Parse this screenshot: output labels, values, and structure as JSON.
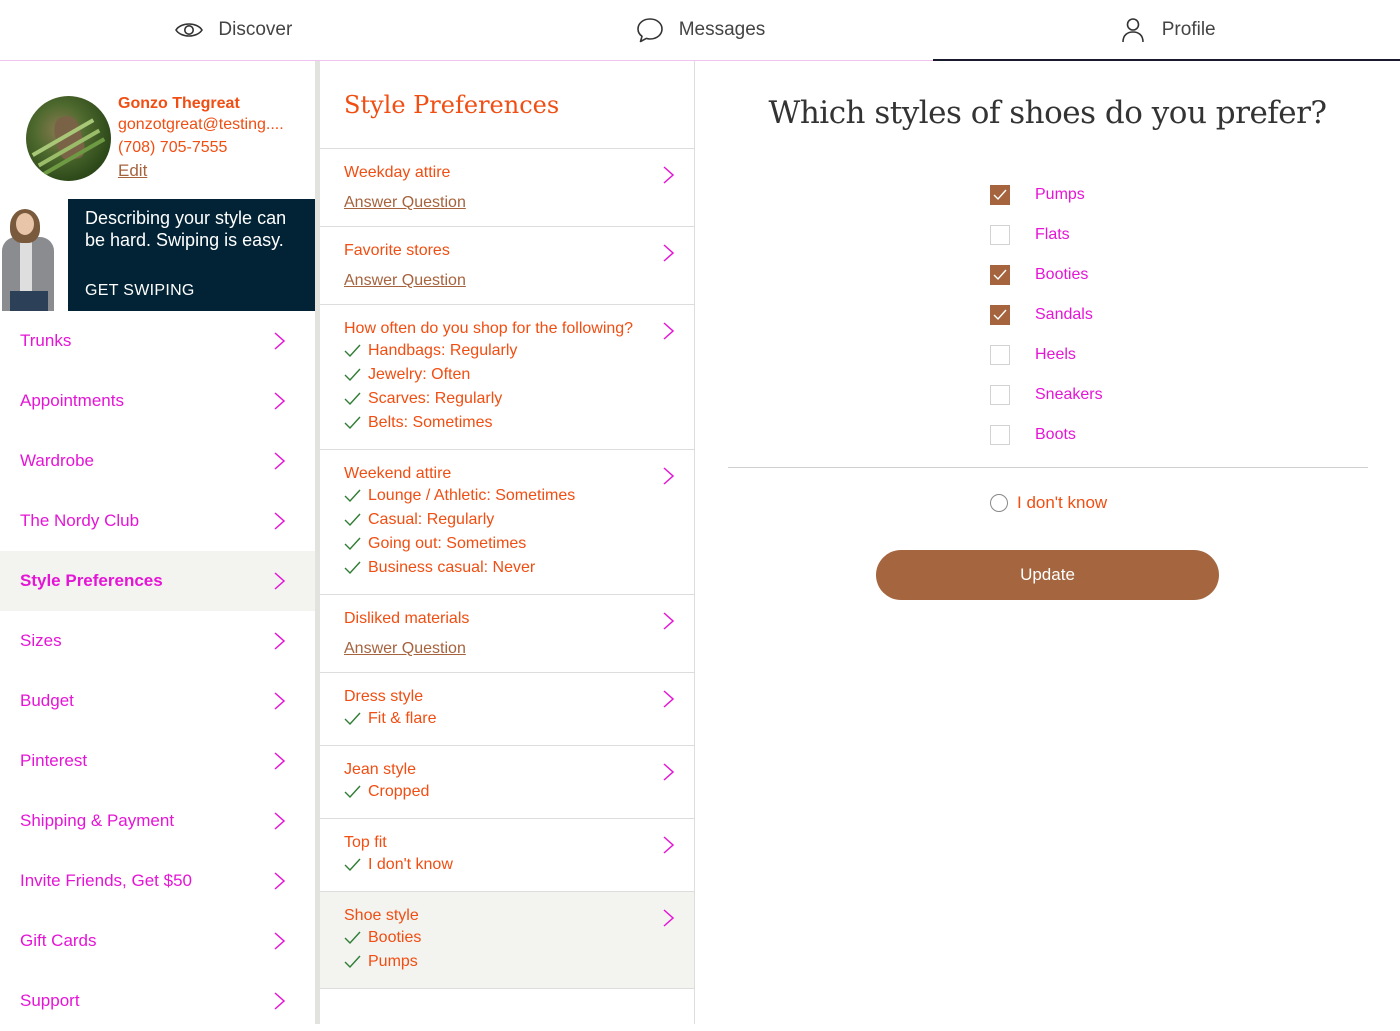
{
  "topnav": {
    "tabs": [
      {
        "label": "Discover",
        "icon": "eye-icon"
      },
      {
        "label": "Messages",
        "icon": "speech-bubble-icon"
      },
      {
        "label": "Profile",
        "icon": "person-icon",
        "active": true
      }
    ]
  },
  "profile": {
    "name": "Gonzo Thegreat",
    "email": "gonzotgreat@testing....",
    "phone": "(708) 705-7555",
    "edit_label": "Edit"
  },
  "promo": {
    "text": "Describing your style can be hard. Swiping is easy.",
    "cta": "GET SWIPING"
  },
  "sidebar": {
    "items": [
      {
        "label": "Trunks"
      },
      {
        "label": "Appointments"
      },
      {
        "label": "Wardrobe"
      },
      {
        "label": "The Nordy Club"
      },
      {
        "label": "Style Preferences",
        "active": true
      },
      {
        "label": "Sizes"
      },
      {
        "label": "Budget"
      },
      {
        "label": "Pinterest"
      },
      {
        "label": "Shipping & Payment"
      },
      {
        "label": "Invite Friends, Get $50"
      },
      {
        "label": "Gift Cards"
      },
      {
        "label": "Support"
      }
    ]
  },
  "middle": {
    "title": "Style Preferences",
    "answer_link": "Answer Question",
    "questions": [
      {
        "title": "Weekday attire",
        "answers": []
      },
      {
        "title": "Favorite stores",
        "answers": []
      },
      {
        "title": "How often do you shop for the following?",
        "answers": [
          "Handbags: Regularly",
          "Jewelry: Often",
          "Scarves: Regularly",
          "Belts: Sometimes"
        ]
      },
      {
        "title": "Weekend attire",
        "answers": [
          "Lounge / Athletic: Sometimes",
          "Casual: Regularly",
          "Going out: Sometimes",
          "Business casual: Never"
        ]
      },
      {
        "title": "Disliked materials",
        "answers": []
      },
      {
        "title": "Dress style",
        "answers": [
          "Fit & flare"
        ]
      },
      {
        "title": "Jean style",
        "answers": [
          "Cropped"
        ]
      },
      {
        "title": "Top fit",
        "answers": [
          "I don't know"
        ]
      },
      {
        "title": "Shoe style",
        "answers": [
          "Booties",
          "Pumps"
        ],
        "active": true
      }
    ]
  },
  "panel": {
    "question": "Which styles of shoes do you prefer?",
    "options": [
      {
        "label": "Pumps",
        "checked": true
      },
      {
        "label": "Flats",
        "checked": false
      },
      {
        "label": "Booties",
        "checked": true
      },
      {
        "label": "Sandals",
        "checked": true
      },
      {
        "label": "Heels",
        "checked": false
      },
      {
        "label": "Sneakers",
        "checked": false
      },
      {
        "label": "Boots",
        "checked": false
      }
    ],
    "idk_label": "I don't know",
    "update_label": "Update"
  },
  "colors": {
    "accent_orange": "#f04e12",
    "accent_magenta": "#e515d6",
    "brown": "#a5633e",
    "promo_bg": "#022335",
    "check_green": "#2e7d32"
  }
}
